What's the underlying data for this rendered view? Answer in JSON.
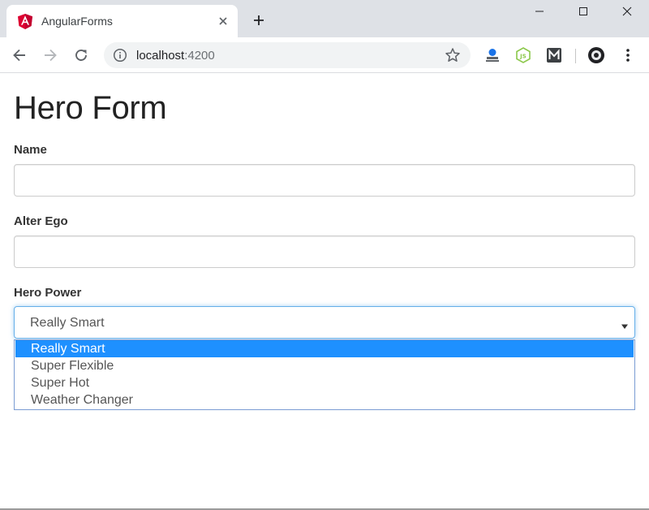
{
  "browser": {
    "tab_title": "AngularForms",
    "url_host": "localhost",
    "url_port": ":4200",
    "icons": {
      "favicon": "angular-logo-icon",
      "tab_close": "close-icon",
      "new_tab": "plus-icon",
      "back": "arrow-left-icon",
      "forward": "arrow-right-icon",
      "reload": "reload-icon",
      "site_info": "info-icon",
      "bookmark": "star-icon",
      "menu": "kebab-menu-icon"
    },
    "colors": {
      "titlebar": "#dee1e6",
      "omnibox": "#f1f3f4",
      "angular_red": "#dd0031"
    }
  },
  "form": {
    "title": "Hero Form",
    "name_label": "Name",
    "name_value": "",
    "alter_ego_label": "Alter Ego",
    "alter_ego_value": "",
    "power_label": "Hero Power",
    "power_selected": "Really Smart",
    "power_options": [
      "Really Smart",
      "Super Flexible",
      "Super Hot",
      "Weather Changer"
    ],
    "colors": {
      "focus_border": "#66afe9",
      "option_highlight": "#1e90ff"
    }
  }
}
